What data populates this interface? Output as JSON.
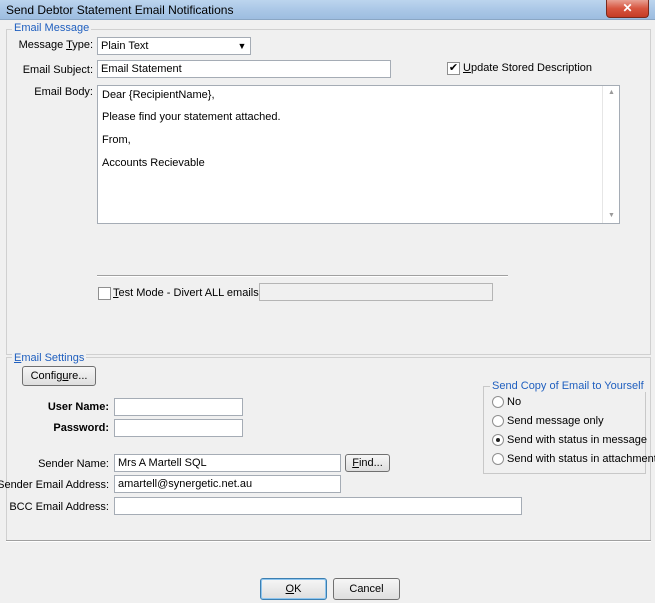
{
  "window": {
    "title": "Send Debtor Statement Email Notifications",
    "close_glyph": "✕"
  },
  "email_message": {
    "group_label": "Email Message",
    "message_type": {
      "label_pre": "Message ",
      "label_ul": "T",
      "label_post": "ype:",
      "value": "Plain Text",
      "dropdown_icon": "chevron-down-icon"
    },
    "subject": {
      "label": "Email Subject:",
      "value": "Email Statement"
    },
    "update_stored_description": {
      "label_ul": "U",
      "label_post": "pdate Stored Description",
      "checked": true,
      "check_glyph": "✔"
    },
    "body": {
      "label": "Email Body:",
      "lines": [
        "Dear {RecipientName},",
        "Please find your statement attached.",
        "From,",
        "Accounts Recievable"
      ],
      "scroll_up": "▲",
      "scroll_down": "▼"
    },
    "test_mode": {
      "label_ul": "T",
      "label_post": "est Mode - Divert ALL emails to:",
      "checked": false,
      "value": ""
    }
  },
  "email_settings": {
    "group_label_ul": "E",
    "group_label_post": "mail Settings",
    "configure_button_pre": "Config",
    "configure_button_ul": "u",
    "configure_button_post": "re...",
    "user_name": {
      "label": "User Name:",
      "value": ""
    },
    "password": {
      "label": "Password:",
      "value": ""
    },
    "sender_name": {
      "label": "Sender Name:",
      "value": "Mrs A Martell SQL"
    },
    "find_button_ul": "F",
    "find_button_post": "ind...",
    "sender_email": {
      "label": "Sender Email Address:",
      "value": "amartell@synergetic.net.au"
    },
    "bcc_email": {
      "label": "BCC Email Address:",
      "value": ""
    }
  },
  "send_copy": {
    "group_label": "Send Copy of Email to Yourself",
    "options": [
      {
        "label": "No",
        "selected": false
      },
      {
        "label": "Send message only",
        "selected": false
      },
      {
        "label": "Send with status in message",
        "selected": true
      },
      {
        "label": "Send with status in attachment",
        "selected": false
      }
    ]
  },
  "footer": {
    "ok_label_ul": "O",
    "ok_label_post": "K",
    "cancel_label": "Cancel"
  }
}
